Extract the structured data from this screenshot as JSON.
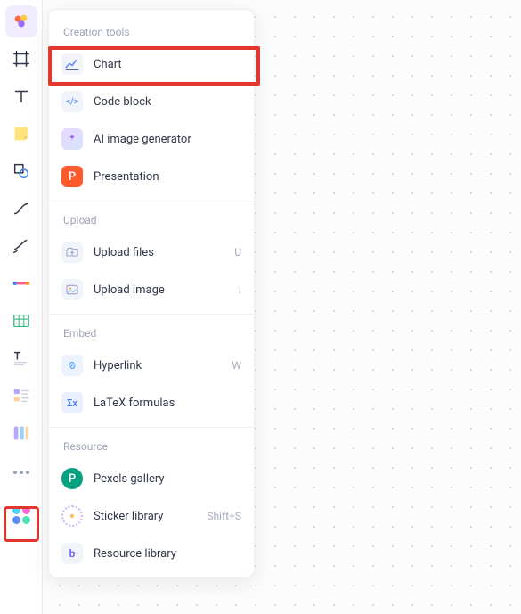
{
  "toolbar": {
    "tools": [
      {
        "name": "logo"
      },
      {
        "name": "frame"
      },
      {
        "name": "text"
      },
      {
        "name": "sticky"
      },
      {
        "name": "shape"
      },
      {
        "name": "connector"
      },
      {
        "name": "pen"
      },
      {
        "name": "highlighter"
      },
      {
        "name": "table"
      },
      {
        "name": "text-block"
      },
      {
        "name": "card-layout"
      },
      {
        "name": "columns"
      },
      {
        "name": "more"
      },
      {
        "name": "apps"
      }
    ]
  },
  "panel": {
    "sections": {
      "creation": {
        "title": "Creation tools",
        "items": [
          {
            "label": "Chart",
            "icon": "chart"
          },
          {
            "label": "Code block",
            "icon": "code"
          },
          {
            "label": "AI image generator",
            "icon": "ai-image"
          },
          {
            "label": "Presentation",
            "icon": "presentation"
          }
        ]
      },
      "upload": {
        "title": "Upload",
        "items": [
          {
            "label": "Upload files",
            "shortcut": "U",
            "icon": "upload-files"
          },
          {
            "label": "Upload image",
            "shortcut": "I",
            "icon": "upload-image"
          }
        ]
      },
      "embed": {
        "title": "Embed",
        "items": [
          {
            "label": "Hyperlink",
            "shortcut": "W",
            "icon": "hyperlink"
          },
          {
            "label": "LaTeX formulas",
            "icon": "latex"
          }
        ]
      },
      "resource": {
        "title": "Resource",
        "items": [
          {
            "label": "Pexels gallery",
            "icon": "pexels"
          },
          {
            "label": "Sticker library",
            "shortcut": "Shift+S",
            "icon": "sticker"
          },
          {
            "label": "Resource library",
            "icon": "resource"
          }
        ]
      }
    }
  },
  "colors": {
    "highlight": "#e1372f",
    "accent": "#6b5cff",
    "presentation": "#ff5a2c",
    "pexels": "#07a081",
    "link": "#5aa7ff",
    "latex": "#4f7dff"
  }
}
